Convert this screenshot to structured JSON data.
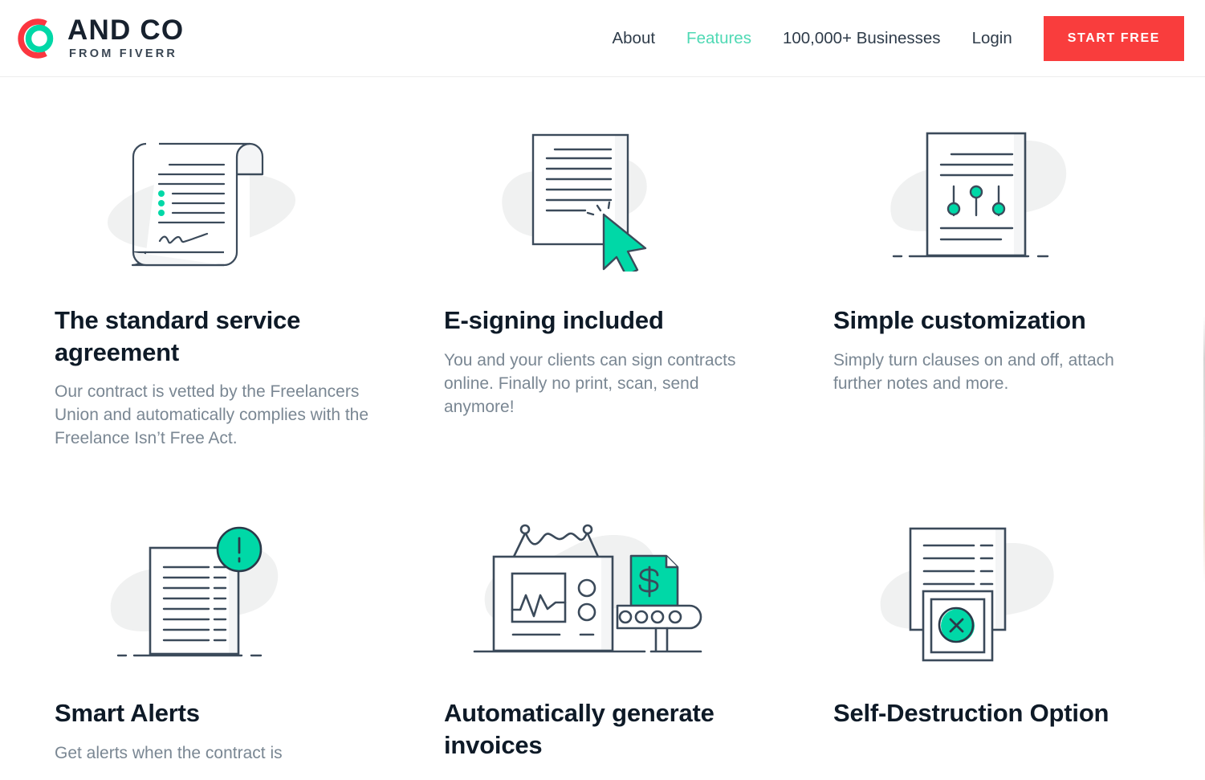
{
  "header": {
    "logo": {
      "title": "AND CO",
      "subtitle": "FROM FIVERR",
      "icon_name": "andco-logo-icon",
      "ring_outer_color": "#fb3640",
      "ring_inner_color": "#00d8a7"
    },
    "nav": [
      {
        "label": "About",
        "active": false
      },
      {
        "label": "Features",
        "active": true
      },
      {
        "label": "100,000+ Businesses",
        "active": false
      },
      {
        "label": "Login",
        "active": false
      }
    ],
    "cta": {
      "label": "START FREE",
      "background": "#f93d3d",
      "color": "#ffffff"
    }
  },
  "theme": {
    "accent_teal": "#00d8a7",
    "accent_red": "#f93d3d",
    "ink": "#3b4a5a",
    "heading": "#0e1a27",
    "body_text": "#7a8793",
    "blob": "#f0f1f1"
  },
  "features": [
    {
      "icon": "contract-scroll-icon",
      "title": "The standard service agreement",
      "description": "Our contract is vetted by the Freelancers Union and automatically complies with the Freelance Isn’t Free Act."
    },
    {
      "icon": "document-cursor-click-icon",
      "title": "E-signing included",
      "description": "You and your clients can sign contracts online. Finally no print, scan, send anymore!"
    },
    {
      "icon": "document-sliders-icon",
      "title": "Simple customization",
      "description": "Simply turn clauses on and off, attach further notes and more."
    },
    {
      "icon": "document-alert-badge-icon",
      "title": "Smart Alerts",
      "description": "Get alerts when the contract is"
    },
    {
      "icon": "invoice-machine-conveyor-icon",
      "title": "Automatically generate invoices",
      "description": ""
    },
    {
      "icon": "document-self-destruct-icon",
      "title": "Self-Destruction Option",
      "description": ""
    }
  ]
}
